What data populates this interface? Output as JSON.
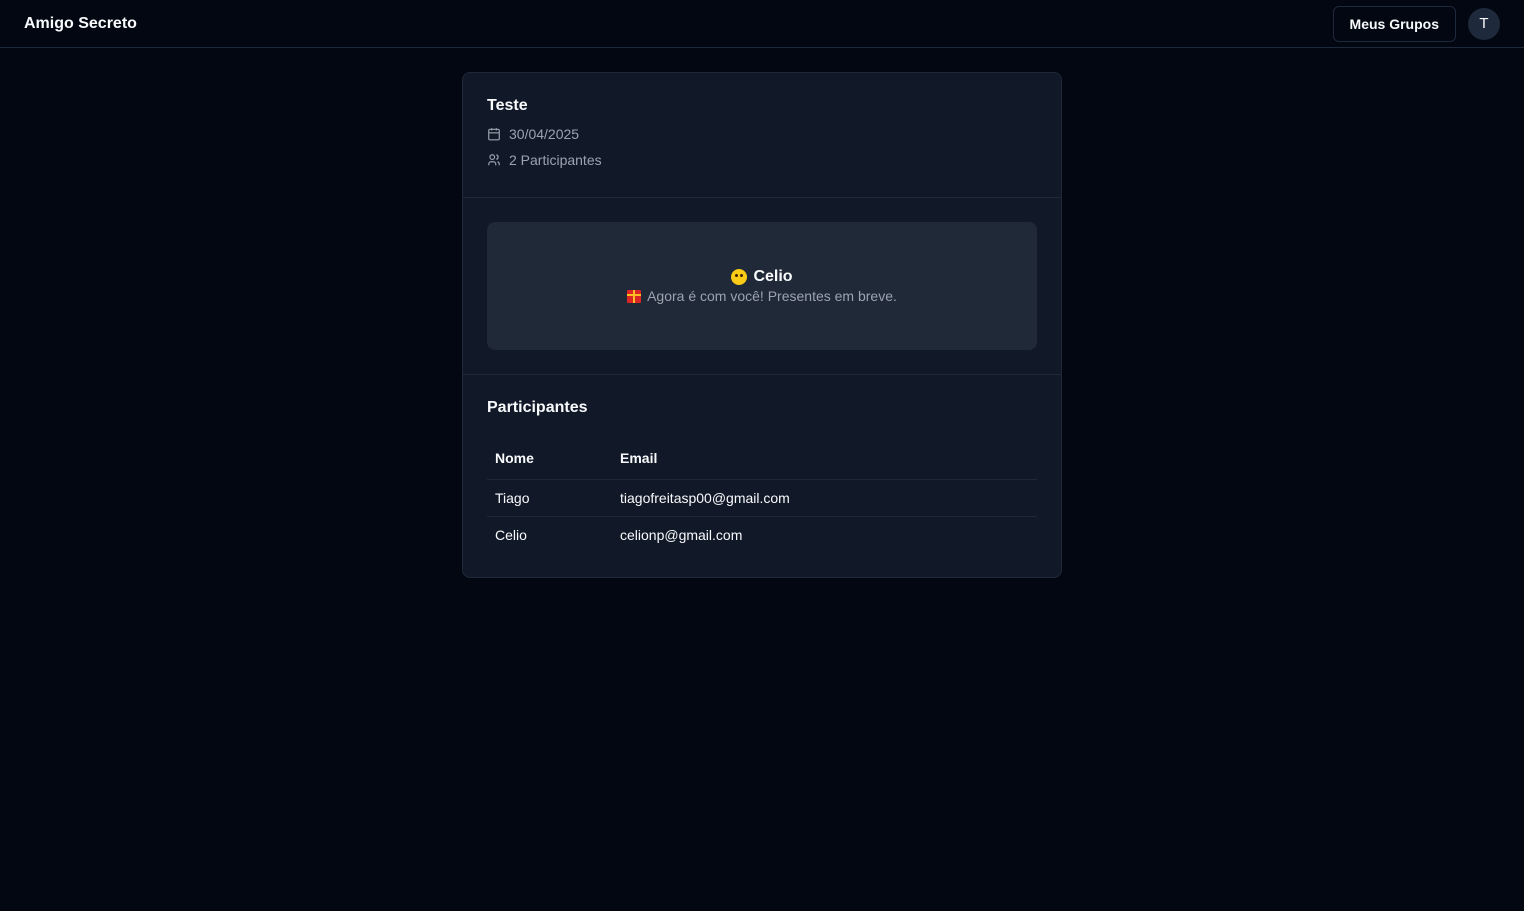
{
  "app": {
    "title": "Amigo Secreto"
  },
  "header": {
    "groups_button": "Meus Grupos",
    "avatar_initial": "T"
  },
  "group": {
    "name": "Teste",
    "date": "30/04/2025",
    "participants_count": "2 Participantes"
  },
  "draw": {
    "name": "Celio",
    "message": "Agora é com você! Presentes em breve."
  },
  "participants": {
    "title": "Participantes",
    "columns": {
      "name": "Nome",
      "email": "Email"
    },
    "rows": [
      {
        "name": "Tiago",
        "email": "tiagofreitasp00@gmail.com"
      },
      {
        "name": "Celio",
        "email": "celionp@gmail.com"
      }
    ]
  },
  "icons": {
    "date": "calendar-icon",
    "participants": "users-icon",
    "face": "face-emoji-icon",
    "gift": "gift-emoji-icon"
  }
}
